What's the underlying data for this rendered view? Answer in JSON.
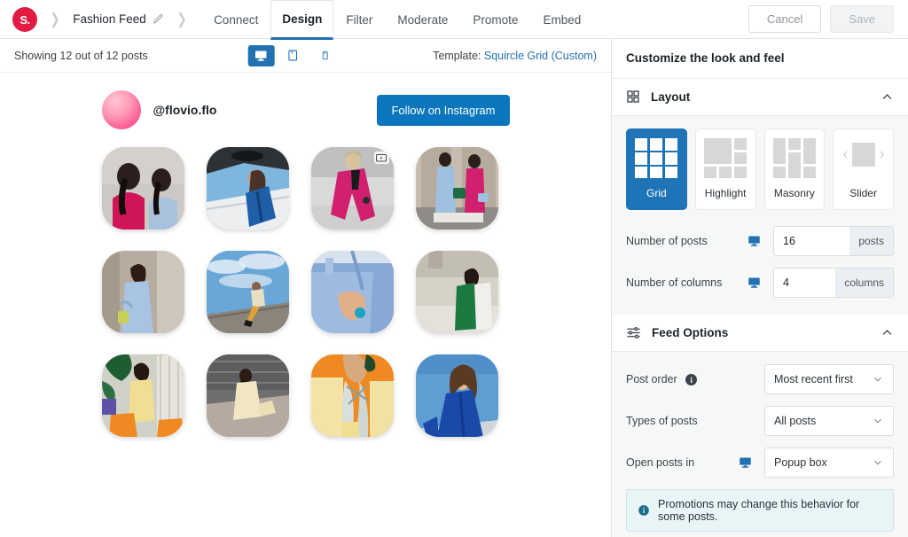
{
  "topbar": {
    "logo_text": "S.",
    "breadcrumb_feed_name": "Fashion Feed",
    "tabs": [
      {
        "label": "Connect",
        "active": false
      },
      {
        "label": "Design",
        "active": true
      },
      {
        "label": "Filter",
        "active": false
      },
      {
        "label": "Moderate",
        "active": false
      },
      {
        "label": "Promote",
        "active": false
      },
      {
        "label": "Embed",
        "active": false
      }
    ],
    "cancel_label": "Cancel",
    "save_label": "Save"
  },
  "preview_toolbar": {
    "showing_text": "Showing 12 out of 12 posts",
    "devices": [
      {
        "name": "desktop",
        "active": true
      },
      {
        "name": "tablet",
        "active": false
      },
      {
        "name": "mobile",
        "active": false
      }
    ],
    "template_label": "Template:",
    "template_value": "Squircle Grid (Custom)"
  },
  "feed": {
    "handle": "@flovio.flo",
    "follow_button": "Follow on Instagram",
    "tiles": [
      {
        "id": 1,
        "alt": "two women in pink and blue suits from behind",
        "is_reel": false
      },
      {
        "id": 2,
        "alt": "woman in blue suit on stairs",
        "is_reel": false
      },
      {
        "id": 3,
        "alt": "woman in magenta coat walking",
        "is_reel": true
      },
      {
        "id": 4,
        "alt": "two women pink and blue suits with bags",
        "is_reel": false
      },
      {
        "id": 5,
        "alt": "woman in light blue coat by wall",
        "is_reel": false
      },
      {
        "id": 6,
        "alt": "person sitting on ledge with clouds",
        "is_reel": false
      },
      {
        "id": 7,
        "alt": "close up of blue trousers and hand",
        "is_reel": false
      },
      {
        "id": 8,
        "alt": "woman in green coat outdoors",
        "is_reel": false
      },
      {
        "id": 9,
        "alt": "woman in yellow suit with plants",
        "is_reel": false
      },
      {
        "id": 10,
        "alt": "woman in cream outfit by water",
        "is_reel": false
      },
      {
        "id": 11,
        "alt": "woman with scarf on orange background",
        "is_reel": false
      },
      {
        "id": 12,
        "alt": "woman in blue blazer under sky",
        "is_reel": false
      }
    ]
  },
  "sidebar": {
    "title": "Customize the look and feel",
    "layout_section": {
      "label": "Layout",
      "expanded": true,
      "options": [
        {
          "label": "Grid",
          "active": true
        },
        {
          "label": "Highlight",
          "active": false
        },
        {
          "label": "Masonry",
          "active": false
        },
        {
          "label": "Slider",
          "active": false
        }
      ],
      "number_of_posts": {
        "label": "Number of posts",
        "value": "16",
        "suffix": "posts",
        "has_device_icon": true
      },
      "number_of_columns": {
        "label": "Number of columns",
        "value": "4",
        "suffix": "columns",
        "has_device_icon": true
      }
    },
    "feed_options_section": {
      "label": "Feed Options",
      "expanded": true,
      "post_order": {
        "label": "Post order",
        "has_info": true,
        "value": "Most recent first"
      },
      "types_of_posts": {
        "label": "Types of posts",
        "value": "All posts"
      },
      "open_posts_in": {
        "label": "Open posts in",
        "value": "Popup box",
        "has_device_icon": true
      },
      "notice": "Promotions may change this behavior for some posts."
    }
  },
  "colors": {
    "brand_red": "#e11b43",
    "accent_blue": "#2271b1",
    "layout_active_blue": "#1f73b7",
    "follow_blue": "#0b76bd",
    "sidebar_bg": "#f6f7f7",
    "notice_bg": "#e9f4f7"
  }
}
